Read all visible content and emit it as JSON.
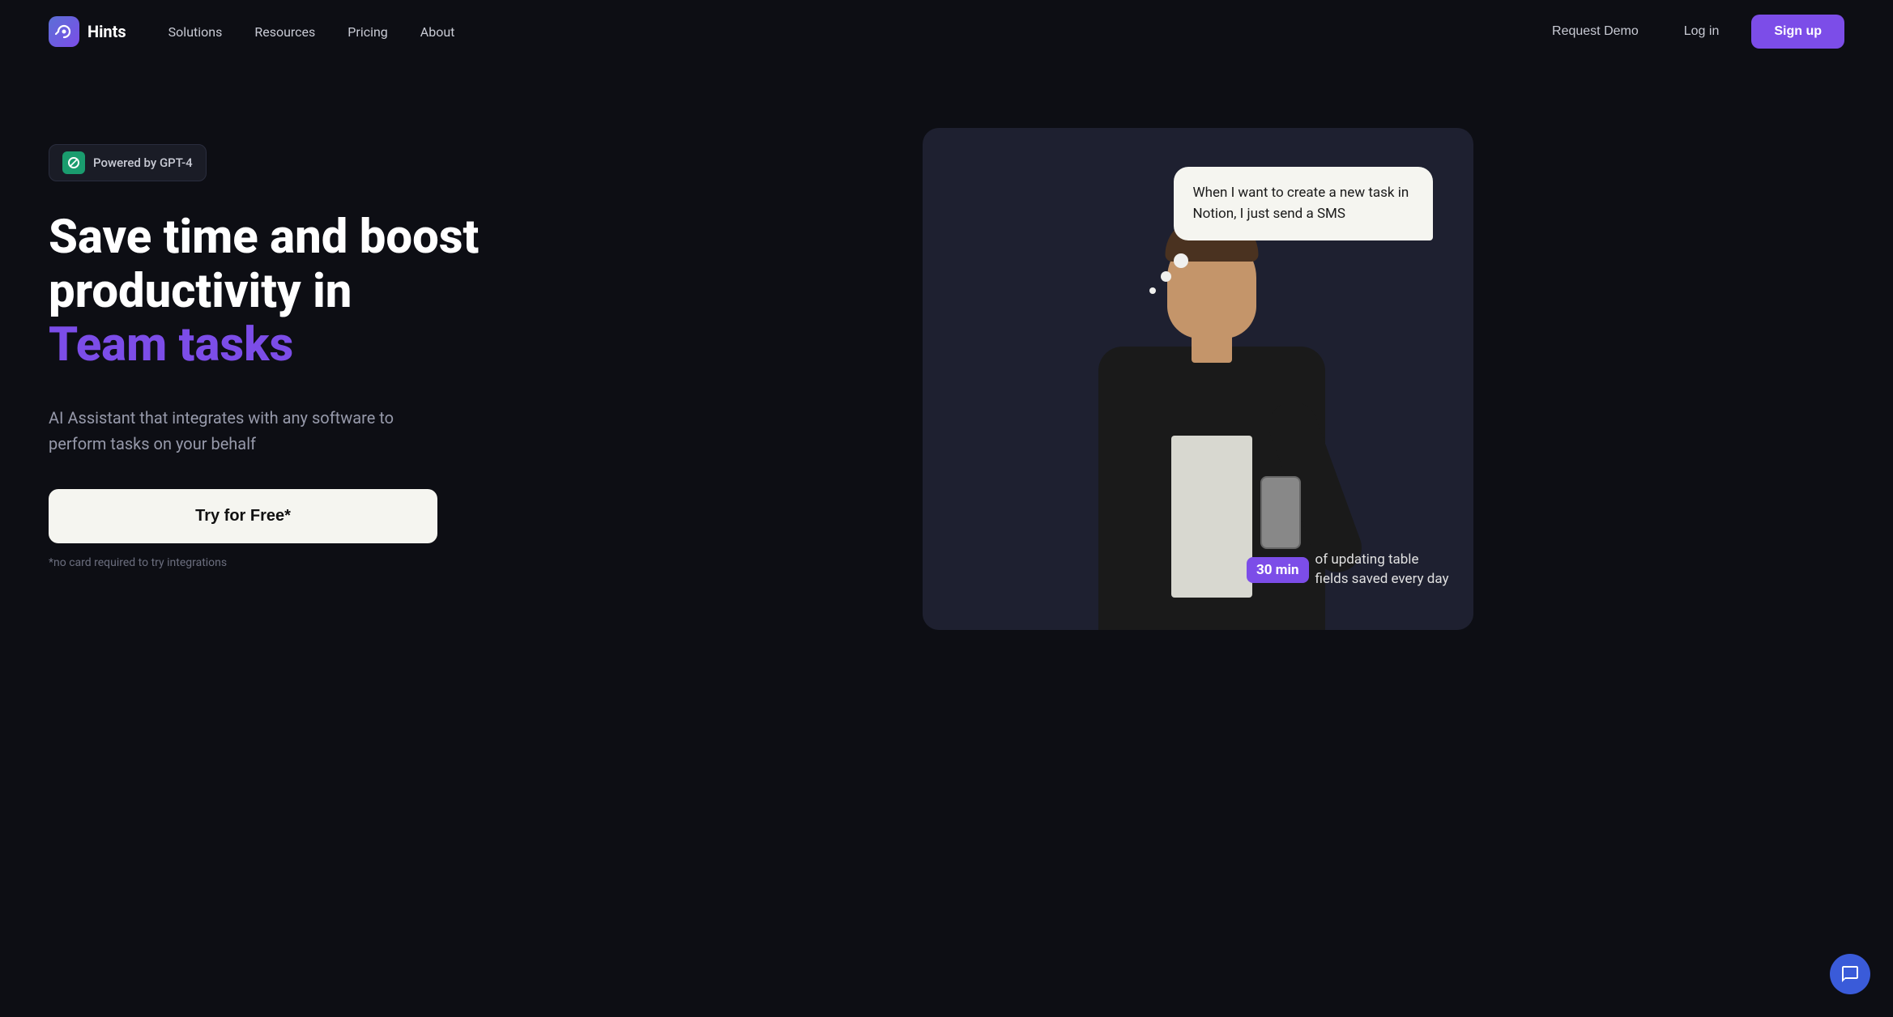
{
  "site": {
    "logo_text": "Hints",
    "logo_icon": "hints-logo"
  },
  "nav": {
    "links": [
      {
        "id": "solutions",
        "label": "Solutions"
      },
      {
        "id": "resources",
        "label": "Resources"
      },
      {
        "id": "pricing",
        "label": "Pricing"
      },
      {
        "id": "about",
        "label": "About"
      }
    ],
    "request_demo": "Request Demo",
    "login": "Log in",
    "signup": "Sign up"
  },
  "hero": {
    "badge_text": "Powered by GPT-4",
    "headline_line1": "Save time and boost",
    "headline_line2": "productivity in",
    "headline_colored": "Team tasks",
    "subtext": "AI Assistant that integrates with any software to perform tasks on your behalf",
    "cta_button": "Try for Free*",
    "cta_note": "*no card required to try integrations"
  },
  "demo": {
    "chat_message": "When I want to create a new task in Notion, I just send a SMS",
    "stat_minutes": "30 min",
    "stat_text": "of updating table\nfields saved every day"
  },
  "support": {
    "icon": "chat-icon"
  }
}
